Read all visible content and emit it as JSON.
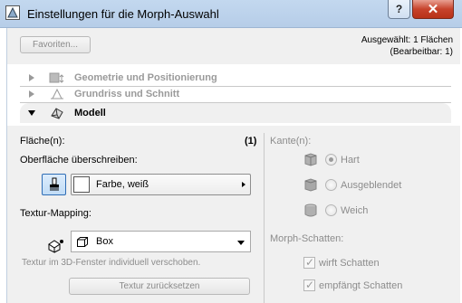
{
  "window": {
    "title": "Einstellungen für die Morph-Auswahl",
    "help_label": "?",
    "close_label": "✕"
  },
  "top": {
    "favorites_label": "Favoriten...",
    "selected_text": "Ausgewählt: 1 Flächen",
    "editable_text": "(Bearbeitbar: 1)"
  },
  "tree": {
    "items": [
      {
        "label": "Geometrie und Positionierung",
        "icon": "geometry-icon",
        "expanded": false
      },
      {
        "label": "Grundriss und Schnitt",
        "icon": "floorplan-icon",
        "expanded": false
      },
      {
        "label": "Modell",
        "icon": "model-icon",
        "expanded": true
      }
    ]
  },
  "model": {
    "faces_label": "Fläche(n):",
    "faces_count": "(1)",
    "override_label": "Oberfläche überschreiben:",
    "material_value": "Farbe, weiß",
    "texture_mapping_label": "Textur-Mapping:",
    "texture_mapping_value": "Box",
    "texture_note": "Textur im 3D-Fenster individuell verschoben.",
    "reset_button_label": "Textur zurücksetzen"
  },
  "edges": {
    "label": "Kante(n):",
    "options": [
      {
        "label": "Hart",
        "selected": true
      },
      {
        "label": "Ausgeblendet",
        "selected": false
      },
      {
        "label": "Weich",
        "selected": false
      }
    ]
  },
  "shadows": {
    "label": "Morph-Schatten:",
    "cast_label": "wirft Schatten",
    "cast_checked": true,
    "receive_label": "empfängt Schatten",
    "receive_checked": true
  },
  "colors": {
    "titlebar": "#c3d8ef",
    "close_button": "#c7432c",
    "panel_bg": "#f0f0f0",
    "disabled_text": "#8c8c8c"
  }
}
